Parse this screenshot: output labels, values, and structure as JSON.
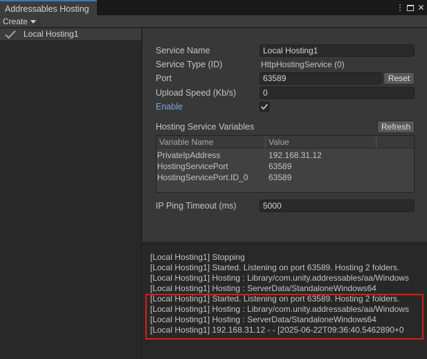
{
  "window": {
    "tab_title": "Addressables Hosting",
    "menu_glyph": "⋮",
    "close_glyph": "✕"
  },
  "toolbar": {
    "create_label": "Create"
  },
  "services": [
    {
      "label": "Local Hosting1",
      "selected": true
    }
  ],
  "properties": {
    "service_name_label": "Service Name",
    "service_name_value": "Local Hosting1",
    "service_type_label": "Service Type (ID)",
    "service_type_value": "HttpHostingService (0)",
    "port_label": "Port",
    "port_value": "63589",
    "reset_label": "Reset",
    "upload_speed_label": "Upload Speed (Kb/s)",
    "upload_speed_value": "0",
    "enable_label": "Enable",
    "enable_checked": true,
    "variables_heading": "Hosting Service Variables",
    "refresh_label": "Refresh",
    "ping_timeout_label": "IP Ping Timeout (ms)",
    "ping_timeout_value": "5000"
  },
  "variables": {
    "headers": [
      "Variable Name",
      "Value"
    ],
    "rows": [
      {
        "name": "PrivateIpAddress",
        "value": "192.168.31.12"
      },
      {
        "name": "HostingServicePort",
        "value": "63589"
      },
      {
        "name": "HostingServicePort.ID_0",
        "value": "63589"
      }
    ]
  },
  "log": [
    "[Local Hosting1] Stopping",
    "[Local Hosting1] Started. Listening on port 63589. Hosting 2 folders.",
    "[Local Hosting1] Hosting : Library/com.unity.addressables/aa/Windows",
    "[Local Hosting1] Hosting : ServerData/StandaloneWindows64",
    "[Local Hosting1] Started. Listening on port 63589. Hosting 2 folders.",
    "[Local Hosting1] Hosting : Library/com.unity.addressables/aa/Windows",
    "[Local Hosting1] Hosting : ServerData/StandaloneWindows64",
    "[Local Hosting1] 192.168.31.12 - - [2025-06-22T09:36:40.5462890+0"
  ],
  "colors": {
    "accent_tab": "#3a79bb",
    "enable_link": "#7aa7e0",
    "highlight": "#e11a1a"
  }
}
